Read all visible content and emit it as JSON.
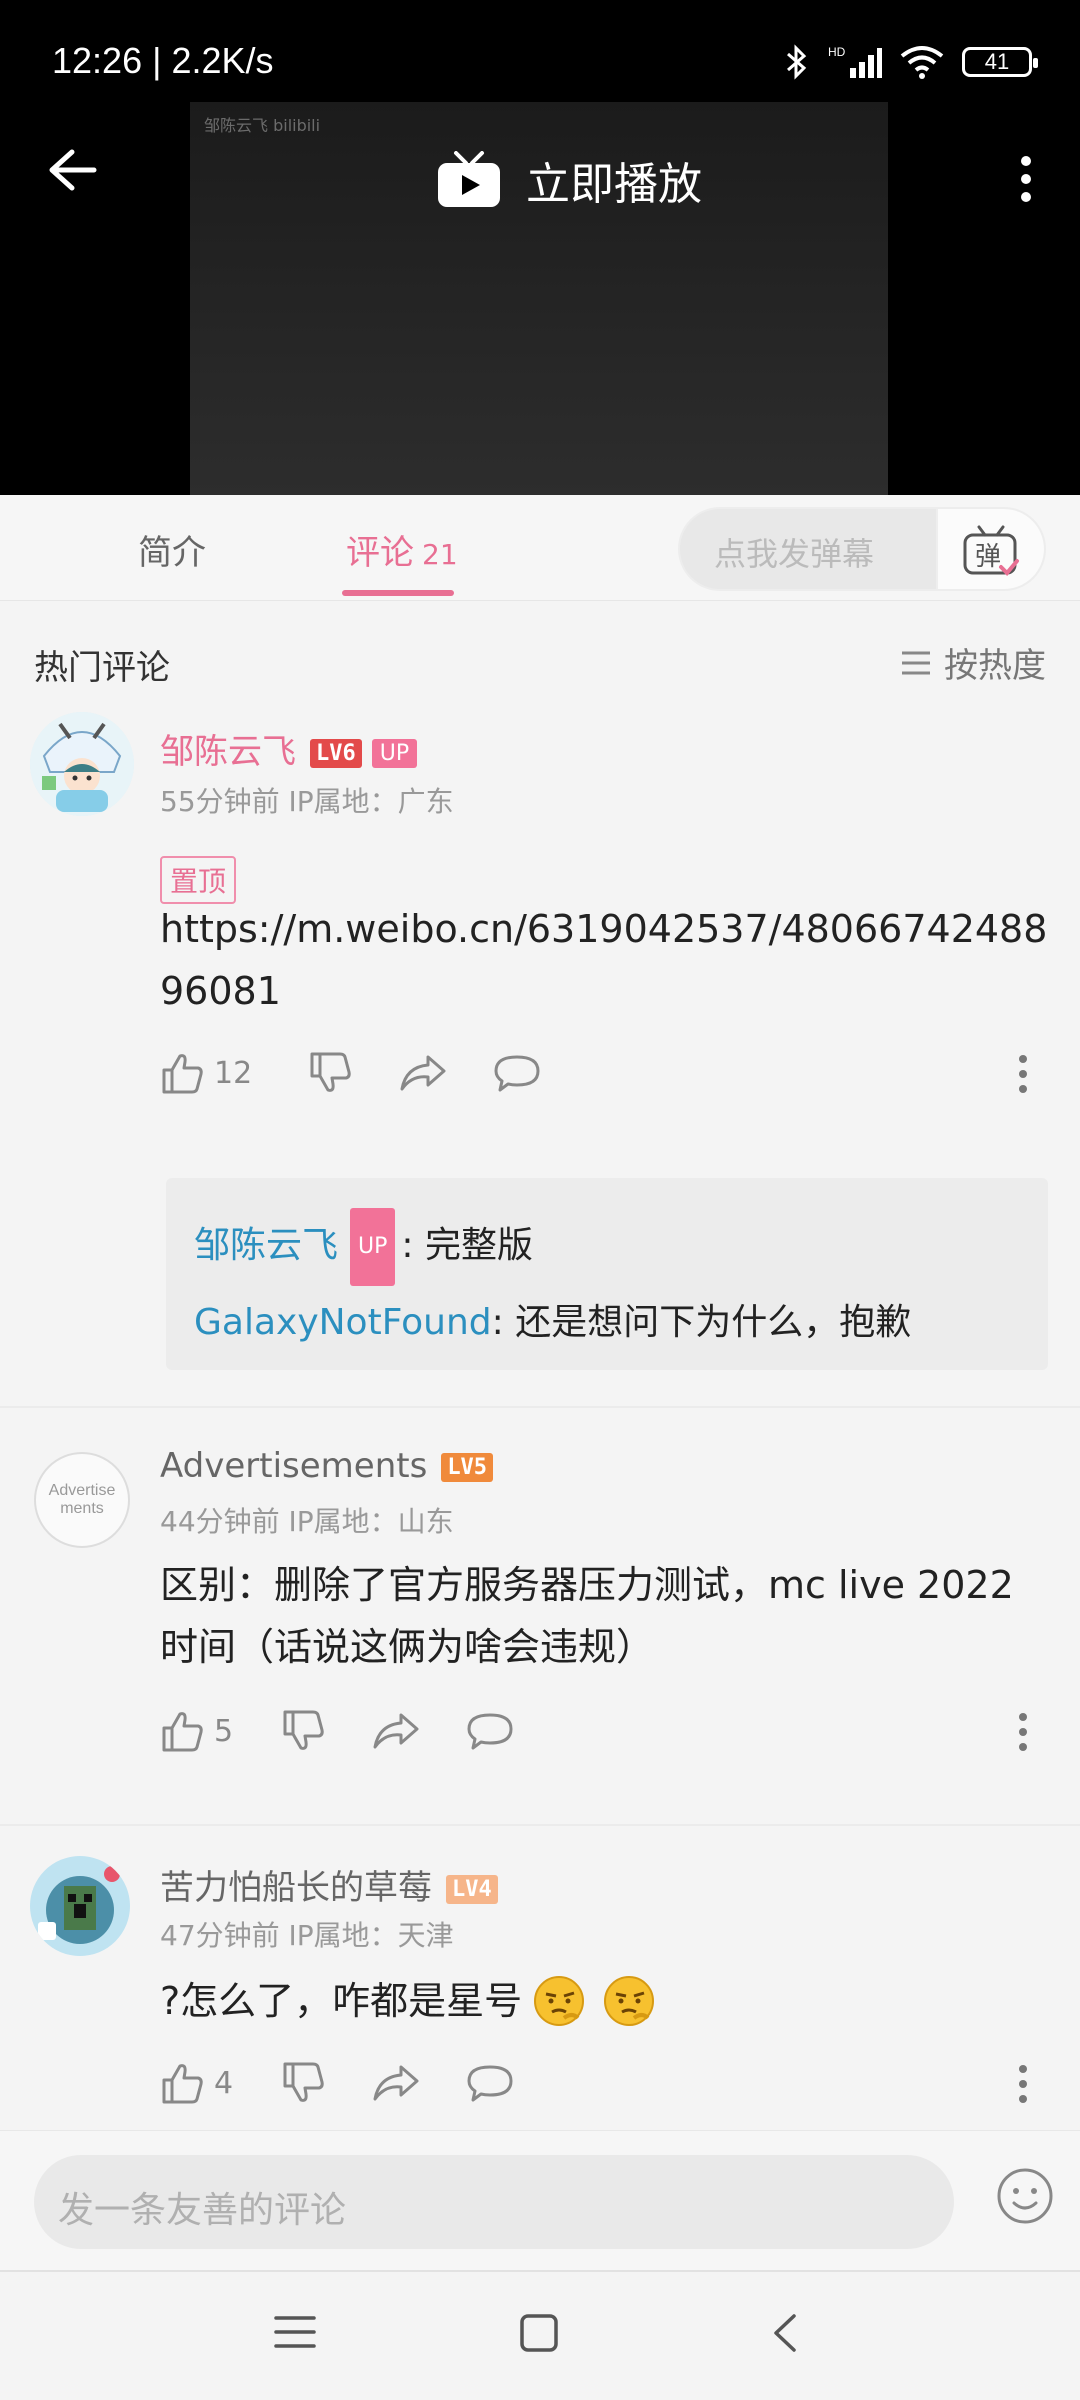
{
  "status_bar": {
    "time_speed": "12:26 | 2.2K/s",
    "battery": "41"
  },
  "player": {
    "watermark": "邹陈云飞 bilibili",
    "play_label": "立即播放"
  },
  "tabs": {
    "intro": "简介",
    "comments": "评论",
    "comments_count": "21",
    "danmaku_placeholder": "点我发弹幕",
    "danmaku_btn": "弹"
  },
  "section": {
    "title": "热门评论",
    "sort_label": "按热度"
  },
  "comments": [
    {
      "username": "邹陈云飞",
      "level": "LV6",
      "up_badge": "UP",
      "meta": "55分钟前  IP属地：广东",
      "pinned": "置顶",
      "text": "https://m.weibo.cn/6319042537/4806674248896081",
      "likes": "12",
      "replies": [
        {
          "name": "邹陈云飞",
          "up": "UP",
          "text": ": 完整版"
        },
        {
          "name": "GalaxyNotFound",
          "text": ": 还是想问下为什么，抱歉"
        }
      ]
    },
    {
      "username": "Advertisements",
      "avatar_text": "Advertisements",
      "level": "LV5",
      "meta": "44分钟前  IP属地：山东",
      "text": "区别：删除了官方服务器压力测试，mc live 2022时间（话说这俩为啥会违规）",
      "likes": "5"
    },
    {
      "username": "苦力怕船长的草莓",
      "level": "LV4",
      "meta": "47分钟前  IP属地：天津",
      "text": "?怎么了，咋都是星号",
      "likes": "4"
    }
  ],
  "compose": {
    "placeholder": "发一条友善的评论"
  },
  "colors": {
    "accent_pink": "#e86f93",
    "lv6": "#e34a4a",
    "lv5": "#f08a3b",
    "lv4": "#f6b58a",
    "reply_blue": "#2b8fbf"
  }
}
